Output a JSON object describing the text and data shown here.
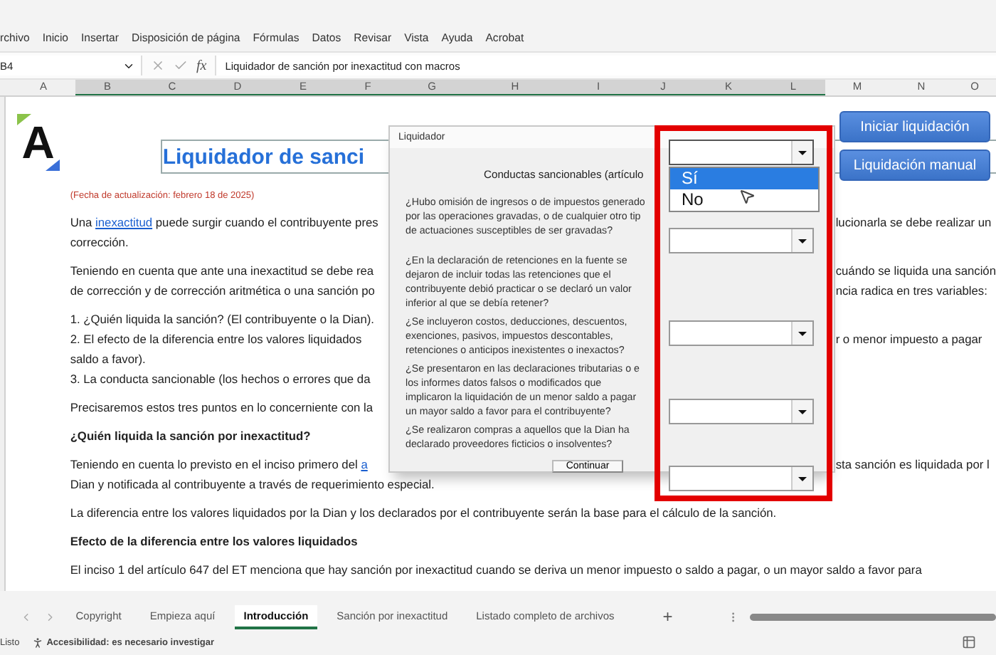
{
  "menu": [
    "rchivo",
    "Inicio",
    "Insertar",
    "Disposición de página",
    "Fórmulas",
    "Datos",
    "Revisar",
    "Vista",
    "Ayuda",
    "Acrobat"
  ],
  "formula_bar": {
    "cell": "B4",
    "fx": "fx",
    "formula": "Liquidador de sanción por inexactitud con macros"
  },
  "columns": [
    {
      "label": "A",
      "selected": false
    },
    {
      "label": "B",
      "selected": true
    },
    {
      "label": "C",
      "selected": true
    },
    {
      "label": "D",
      "selected": true
    },
    {
      "label": "E",
      "selected": true
    },
    {
      "label": "F",
      "selected": true
    },
    {
      "label": "G",
      "selected": true
    },
    {
      "label": "H",
      "selected": true
    },
    {
      "label": "I",
      "selected": true
    },
    {
      "label": "J",
      "selected": true
    },
    {
      "label": "K",
      "selected": true
    },
    {
      "label": "L",
      "selected": true
    },
    {
      "label": "M",
      "selected": false
    },
    {
      "label": "N",
      "selected": false
    },
    {
      "label": "O",
      "selected": false
    }
  ],
  "logo": {
    "text": "A"
  },
  "title": "Liquidador de sanci",
  "updated": "(Fecha de actualización: febrero 18 de 2025)",
  "paragraphs": [
    {
      "kind": "text",
      "lines": [
        {
          "segments": [
            {
              "kind": "plain",
              "text": "Una "
            },
            {
              "kind": "link",
              "text": "inexactitud"
            },
            {
              "kind": "plain",
              "text": " puede surgir cuando el contribuyente pres"
            }
          ],
          "right": "lucionarla se debe realizar un"
        },
        {
          "segments": [
            {
              "kind": "plain",
              "text": "corrección."
            }
          ]
        }
      ]
    },
    {
      "kind": "text",
      "lines": [
        {
          "segments": [
            {
              "kind": "plain",
              "text": "Teniendo en cuenta que ante una inexactitud se debe rea"
            }
          ],
          "right": "cuándo se liquida una sanción"
        },
        {
          "segments": [
            {
              "kind": "plain",
              "text": "de corrección y de corrección aritmética o una sanción po"
            }
          ],
          "right": "ncia radica en tres variables:"
        }
      ]
    },
    {
      "kind": "text",
      "lines": [
        {
          "segments": [
            {
              "kind": "plain",
              "text": "1. ¿Quién liquida la sanción? (El contribuyente o la Dian)."
            }
          ]
        },
        {
          "segments": [
            {
              "kind": "plain",
              "text": "2. El efecto de la diferencia entre los valores liquidados"
            }
          ],
          "right": "r o menor impuesto a pagar"
        },
        {
          "segments": [
            {
              "kind": "plain",
              "text": "saldo a favor)."
            }
          ]
        },
        {
          "segments": [
            {
              "kind": "plain",
              "text": "3. La conducta sancionable (los hechos o errores que da"
            }
          ]
        }
      ]
    },
    {
      "kind": "text",
      "lines": [
        {
          "segments": [
            {
              "kind": "plain",
              "text": "Precisaremos estos tres puntos en lo concerniente con la"
            }
          ]
        }
      ]
    },
    {
      "kind": "heading",
      "lines": [
        {
          "segments": [
            {
              "kind": "plain",
              "text": "¿Quién liquida la sanción por inexactitud?"
            }
          ]
        }
      ]
    },
    {
      "kind": "text",
      "lines": [
        {
          "segments": [
            {
              "kind": "plain",
              "text": "Teniendo en cuenta lo previsto en el inciso primero del "
            },
            {
              "kind": "link",
              "text": "a"
            }
          ],
          "right": "sta sanción es liquidada por l"
        },
        {
          "segments": [
            {
              "kind": "plain",
              "text": "Dian y notificada al contribuyente a través de requerimiento especial."
            }
          ]
        }
      ]
    },
    {
      "kind": "text",
      "lines": [
        {
          "segments": [
            {
              "kind": "plain",
              "text": "La diferencia entre los valores liquidados por la Dian y los declarados por el contribuyente serán la base para el cálculo de la sanción."
            }
          ]
        }
      ]
    },
    {
      "kind": "heading",
      "lines": [
        {
          "segments": [
            {
              "kind": "plain",
              "text": "Efecto de la diferencia entre los valores liquidados"
            }
          ]
        }
      ]
    },
    {
      "kind": "text",
      "lines": [
        {
          "segments": [
            {
              "kind": "plain",
              "text": "El inciso 1 del artículo 647 del ET menciona que hay sanción por inexactitud cuando se deriva un menor impuesto o saldo a pagar, o un mayor saldo a favor para"
            }
          ]
        }
      ]
    }
  ],
  "buttons": [
    "Iniciar liquidación",
    "Liquidación manual"
  ],
  "dialog": {
    "title": "Liquidador",
    "heading": "Conductas sancionables (artículo",
    "questions": [
      "¿Hubo omisión de ingresos o de impuestos generado\npor las operaciones gravadas, o de cualquier otro tip\nde actuaciones susceptibles de ser gravadas?",
      "¿En la declaración de retenciones en la fuente se\ndejaron de incluir todas las retenciones que el\ncontribuyente debió practicar o se declaró un valor\ninferior al que se debía retener?",
      "¿Se incluyeron costos, deducciones, descuentos,\nexenciones, pasivos, impuestos descontables,\nretenciones o anticipos inexistentes o inexactos?",
      "¿Se presentaron en las declaraciones tributarias o e\nlos informes datos falsos o modificados que\nimplicaron la liquidación de un menor saldo a pagar\nun mayor saldo a favor para el contribuyente?",
      "¿Se realizaron compras a aquellos que la Dian ha\ndeclarado proveedores ficticios o insolventes?"
    ],
    "button": "Continuar"
  },
  "combos": [
    {
      "expanded": true,
      "options": [
        {
          "label": "Sí",
          "selected": true
        },
        {
          "label": "No",
          "selected": false
        }
      ]
    },
    {
      "expanded": false
    },
    {
      "expanded": false
    },
    {
      "expanded": false
    },
    {
      "expanded": false
    }
  ],
  "sheet_tabs": [
    {
      "label": "Copyright",
      "selected": false
    },
    {
      "label": "Empieza aquí",
      "selected": false
    },
    {
      "label": "Introducción",
      "selected": true
    },
    {
      "label": "Sanción por inexactitud",
      "selected": false
    },
    {
      "label": "Listado completo de archivos",
      "selected": false
    }
  ],
  "add_sheet": "+",
  "status": {
    "ready": "Listo",
    "accessibility": "Accesibilidad: es necesario investigar"
  }
}
